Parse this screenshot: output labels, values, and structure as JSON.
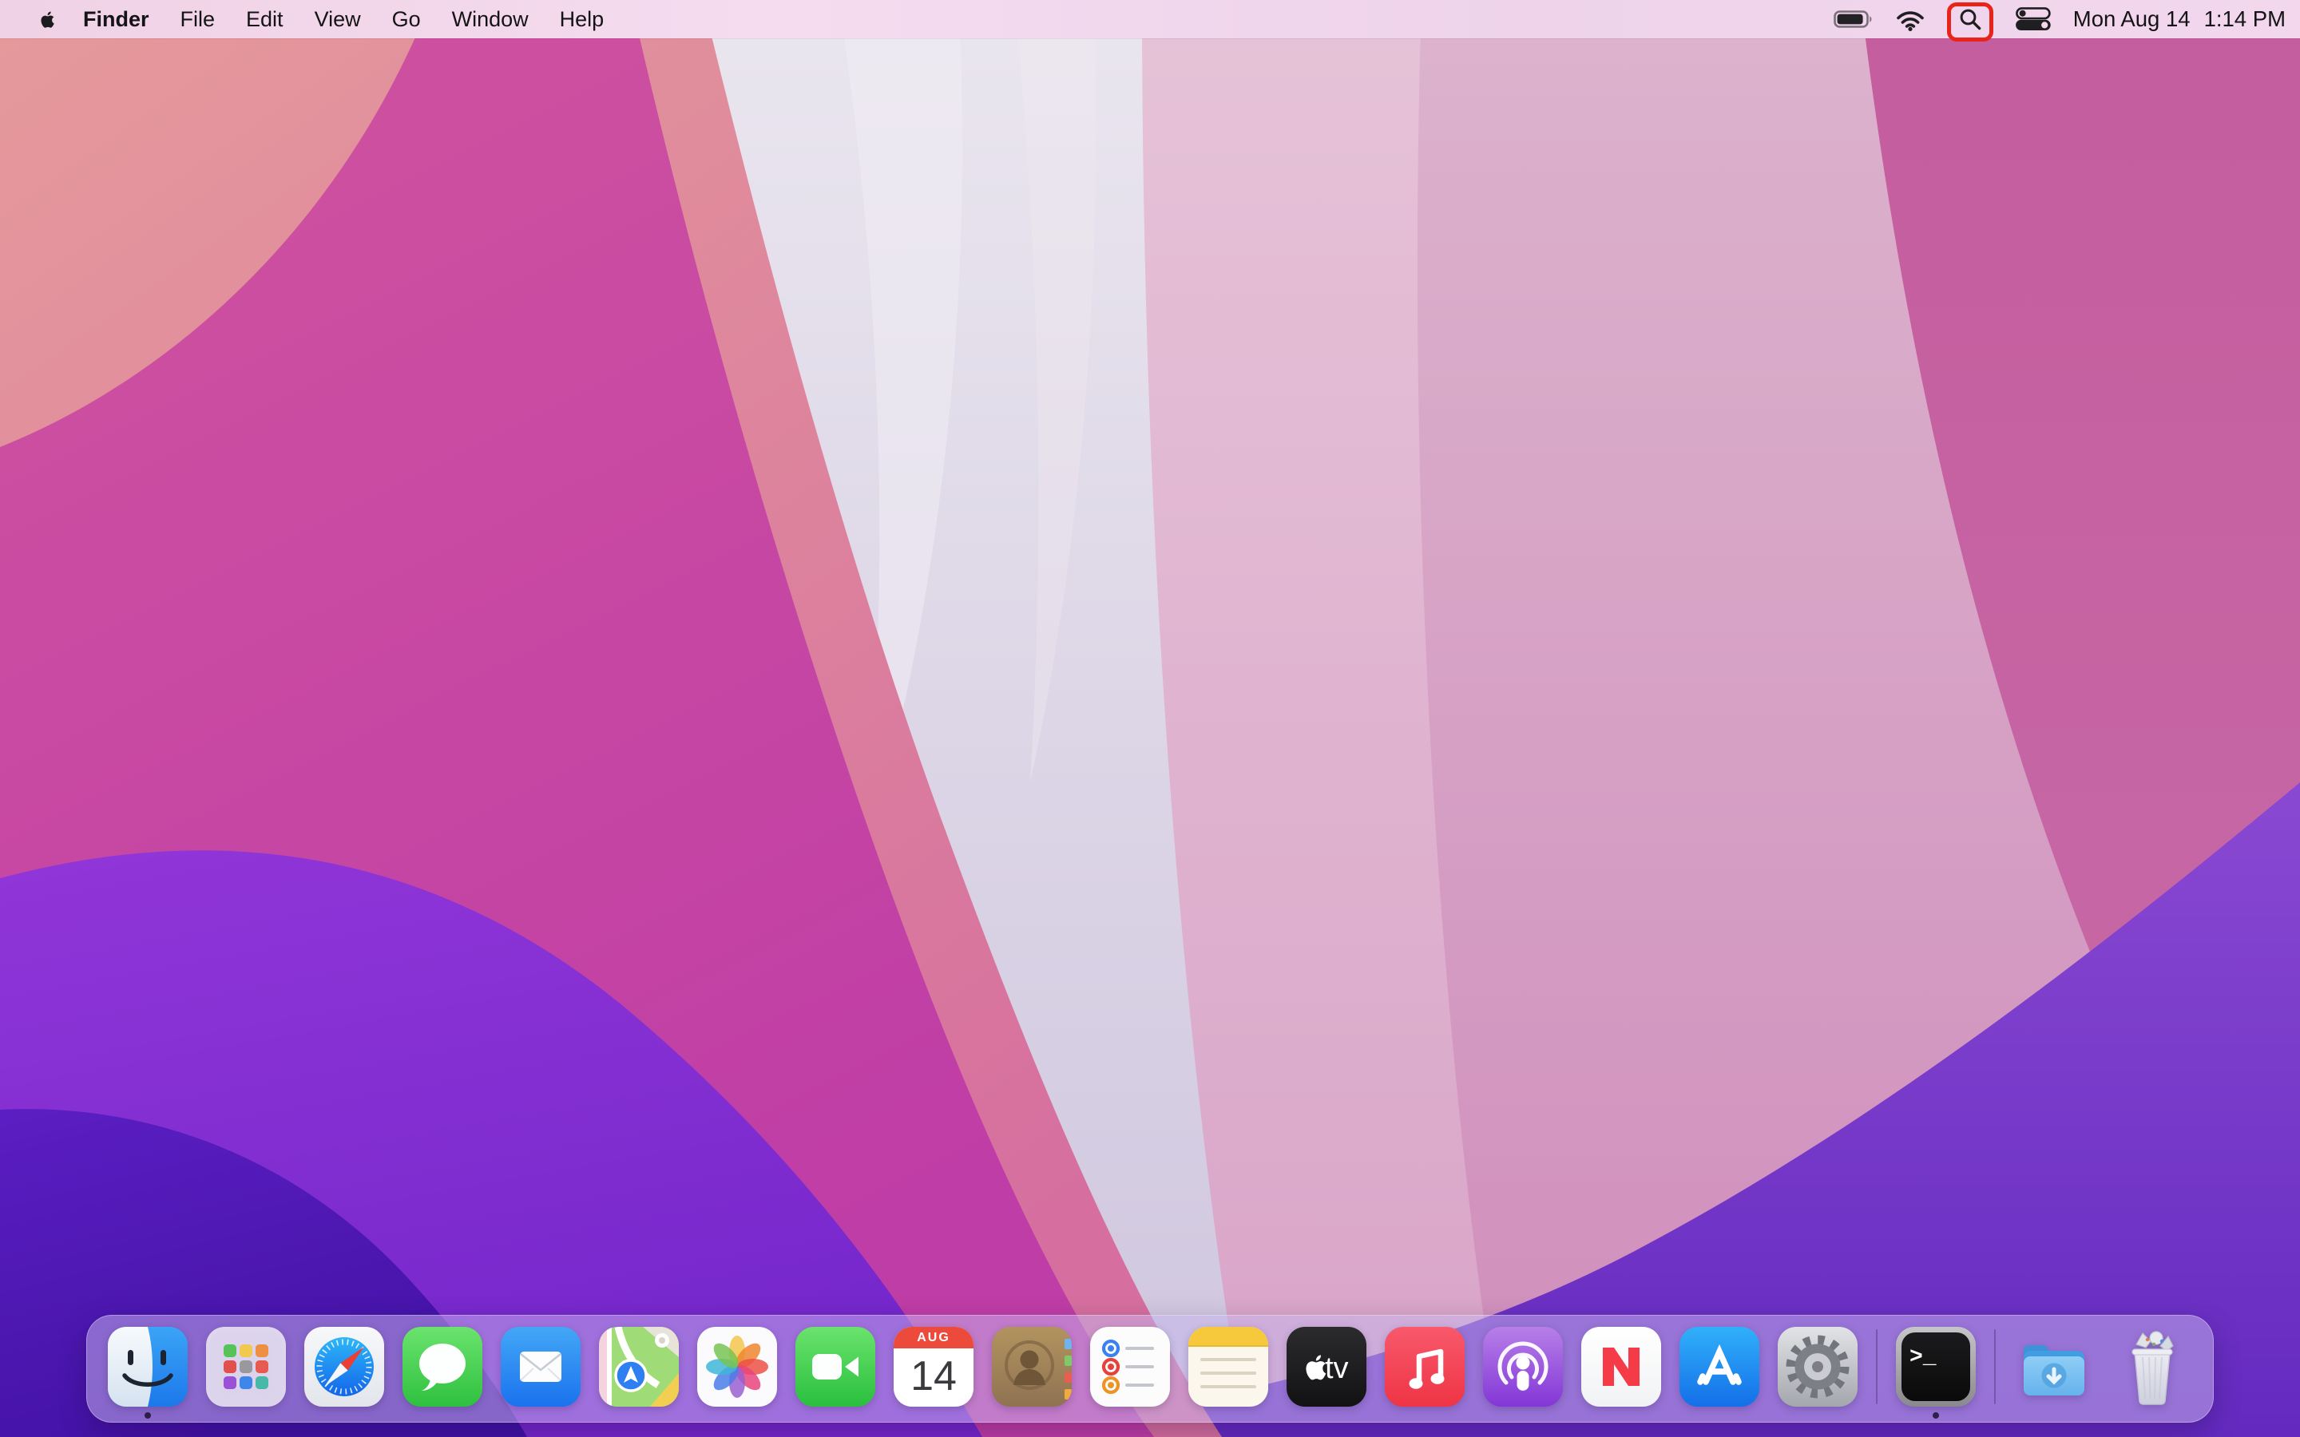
{
  "menu_bar": {
    "app_name": "Finder",
    "menus": [
      "File",
      "Edit",
      "View",
      "Go",
      "Window",
      "Help"
    ],
    "status": {
      "battery_icon": "battery-icon",
      "wifi_icon": "wifi-icon",
      "spotlight_icon": "search-icon",
      "control_center_icon": "control-center-icon",
      "date": "Mon Aug 14",
      "time": "1:14 PM"
    }
  },
  "annotation": {
    "target": "spotlight-search-icon",
    "shape": "rounded-rect-highlight",
    "color": "#e8241a"
  },
  "dock": {
    "apps": [
      {
        "name": "Finder",
        "running": true
      },
      {
        "name": "Launchpad"
      },
      {
        "name": "Safari"
      },
      {
        "name": "Messages"
      },
      {
        "name": "Mail"
      },
      {
        "name": "Maps"
      },
      {
        "name": "Photos"
      },
      {
        "name": "FaceTime"
      },
      {
        "name": "Calendar",
        "month": "AUG",
        "day": "14"
      },
      {
        "name": "Contacts"
      },
      {
        "name": "Reminders"
      },
      {
        "name": "Notes"
      },
      {
        "name": "Apple TV",
        "label": "tv"
      },
      {
        "name": "Music"
      },
      {
        "name": "Podcasts"
      },
      {
        "name": "News"
      },
      {
        "name": "App Store"
      },
      {
        "name": "System Preferences"
      },
      {
        "name": "Terminal",
        "running": true,
        "prompt": ">_"
      },
      {
        "name": "Downloads"
      },
      {
        "name": "Trash",
        "state": "full"
      }
    ]
  },
  "wallpaper": {
    "name": "macOS Monterey abstract waves"
  }
}
